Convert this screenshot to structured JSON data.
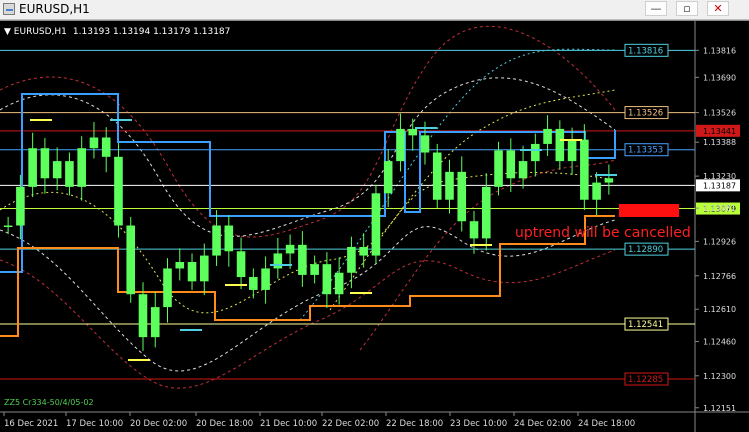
{
  "window": {
    "title": "EURUSD,H1",
    "controls": {
      "minimize": "—",
      "restore": "▫",
      "close": "✕"
    }
  },
  "info_bar": {
    "symbol": "EURUSD,H1",
    "ohlc": "1.13193 1.13194 1.13179 1.13187"
  },
  "indicator_label": "ZZ5 Cr334-50/4/05-02",
  "annotation": {
    "text": "uptrend will be cancelled",
    "color": "#ff2020"
  },
  "colors": {
    "candle": "#5cff5c",
    "cyan": "#4fd0e0",
    "orange": "#ff8c1a",
    "blue": "#4aa3ff",
    "yellow": "#ffff50",
    "red_level": "#d01818",
    "white_level": "#ffffff",
    "lime_level": "#b8ff3a",
    "tan_level": "#f0c080",
    "cream_level": "#ffff99"
  },
  "chart_data": {
    "type": "candlestick",
    "symbol": "EURUSD",
    "timeframe": "H1",
    "y_ticks": [
      "1.13816",
      "1.13690",
      "1.13526",
      "1.13388",
      "1.13230",
      "1.13081",
      "1.12926",
      "1.12766",
      "1.12610",
      "1.12460",
      "1.12300",
      "1.12151"
    ],
    "x_ticks": [
      "16 Dec 2021",
      "17 Dec 10:00",
      "20 Dec 02:00",
      "20 Dec 18:00",
      "21 Dec 10:00",
      "22 Dec 02:00",
      "22 Dec 18:00",
      "23 Dec 10:00",
      "24 Dec 02:00",
      "24 Dec 18:00"
    ],
    "ylim": [
      1.1215,
      1.1392
    ],
    "levels": [
      {
        "value": "1.13816",
        "color": "#4fd0e0",
        "fill": false
      },
      {
        "value": "1.13526",
        "color": "#f0c080",
        "fill": false
      },
      {
        "value": "1.13441",
        "color": "#d01818",
        "fill": true
      },
      {
        "value": "1.13353",
        "color": "#4aa3ff",
        "fill": false
      },
      {
        "value": "1.13187",
        "color": "#ffffff",
        "fill": true
      },
      {
        "value": "1.13079",
        "color": "#b8ff3a",
        "fill": true
      },
      {
        "value": "1.12890",
        "color": "#4fd0e0",
        "fill": false
      },
      {
        "value": "1.12541",
        "color": "#ffff99",
        "fill": false
      },
      {
        "value": "1.12285",
        "color": "#d01818",
        "fill": false
      }
    ],
    "close_series": [
      1.13,
      1.1318,
      1.1336,
      1.1322,
      1.133,
      1.1318,
      1.1336,
      1.1341,
      1.1332,
      1.13,
      1.1268,
      1.1248,
      1.1262,
      1.128,
      1.1283,
      1.1274,
      1.1286,
      1.13,
      1.1288,
      1.1276,
      1.127,
      1.128,
      1.1287,
      1.1291,
      1.1277,
      1.1282,
      1.1268,
      1.1278,
      1.129,
      1.1286,
      1.1315,
      1.133,
      1.1345,
      1.1342,
      1.1334,
      1.1312,
      1.1325,
      1.1302,
      1.1294,
      1.1318,
      1.1335,
      1.1322,
      1.133,
      1.1338,
      1.1345,
      1.133,
      1.134,
      1.1312,
      1.132,
      1.1322
    ]
  }
}
